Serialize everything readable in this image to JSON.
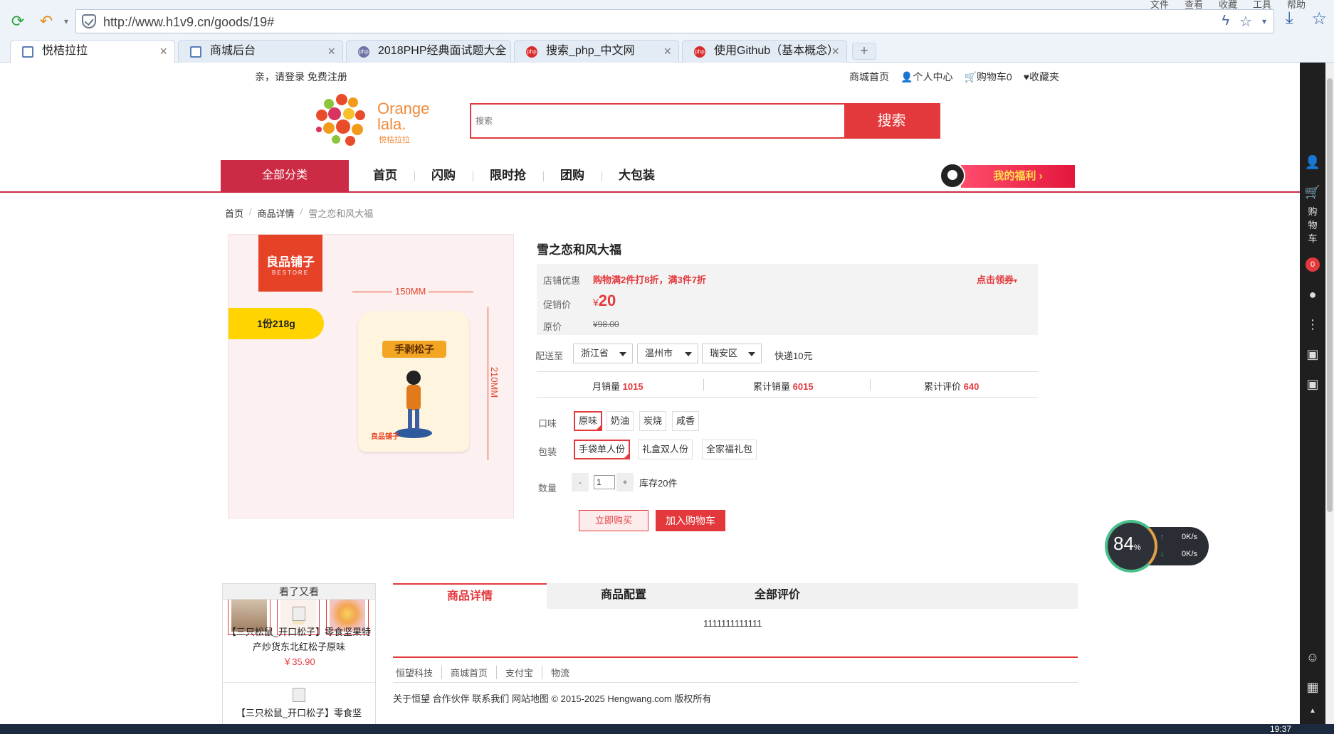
{
  "browser": {
    "menu": [
      "文件",
      "查看",
      "收藏",
      "工具",
      "帮助"
    ],
    "url": "http://www.h1v9.cn/goods/19#",
    "tabs": [
      {
        "title": "悦桔拉拉",
        "icon": "doc"
      },
      {
        "title": "商城后台",
        "icon": "doc"
      },
      {
        "title": "2018PHP经典面试题大全",
        "icon": "php"
      },
      {
        "title": "搜索_php_中文网",
        "icon": "php-red"
      },
      {
        "title": "使用Github（基本概念）",
        "icon": "php-red"
      }
    ],
    "new_tab": "+",
    "sidebar_cart": "购物车",
    "sidebar_cart_count": "0",
    "clock": "19:37"
  },
  "site": {
    "login_prompt": "亲，请登录 免费注册",
    "top_links": [
      "商城首页",
      "个人中心",
      "购物车0",
      "收藏夹"
    ],
    "logo_text": "Orange lala.",
    "logo_sub": "悦桔拉拉",
    "search_placeholder": "搜索",
    "search_button": "搜索",
    "category_button": "全部分类",
    "nav": [
      "首页",
      "闪购",
      "限时抢",
      "团购",
      "大包装"
    ],
    "welfare": "我的福利 ›",
    "breadcrumb": [
      "首页",
      "商品详情",
      "雪之恋和风大福"
    ]
  },
  "product": {
    "title": "雪之恋和风大福",
    "image": {
      "brand": "良品铺子",
      "brand_en": "BESTORE",
      "weight": "1份218g",
      "bag_name": "手剥松子",
      "width_label": "150MM",
      "height_label": "210MM"
    },
    "store_promo_label": "店铺优惠",
    "store_promo": "购物满2件打8折，满3件7折",
    "coupon": "点击领券",
    "price_label": "促销价",
    "currency": "¥",
    "price": "20",
    "orig_price_label": "原价",
    "orig_price": "¥98.00",
    "ship_label": "配送至",
    "province": "浙江省",
    "city": "温州市",
    "district": "瑞安区",
    "shipping": "快递10元",
    "monthly_sales_label": "月销量",
    "monthly_sales": "1015",
    "total_sales_label": "累计销量",
    "total_sales": "6015",
    "reviews_label": "累计评价",
    "reviews": "640",
    "flavor_label": "口味",
    "flavors": [
      "原味",
      "奶油",
      "炭烧",
      "咸香"
    ],
    "selected_flavor": 0,
    "package_label": "包装",
    "packages": [
      "手袋单人份",
      "礼盒双人份",
      "全家福礼包"
    ],
    "selected_package": 0,
    "qty_label": "数量",
    "qty_minus": "-",
    "qty": "1",
    "qty_plus": "+",
    "stock": "库存20件",
    "buy_now": "立即购买",
    "add_cart": "加入购物车"
  },
  "see_also": {
    "title": "看了又看",
    "items": [
      {
        "name": "【三只松鼠_开口松子】零食坚果特产炒货东北红松子原味",
        "price": "￥35.90"
      },
      {
        "name": "【三只松鼠_开口松子】零食坚",
        "price": ""
      }
    ]
  },
  "detail_tabs": [
    "商品详情",
    "商品配置",
    "全部评价"
  ],
  "detail_text": "1111111111111",
  "footer": {
    "links": [
      "恒望科技",
      "商城首页",
      "支付宝",
      "物流"
    ],
    "copyright": "关于恒望 合作伙伴 联系我们 网站地图 © 2015-2025 Hengwang.com 版权所有"
  },
  "speed_widget": {
    "percent": "84",
    "unit": "%",
    "up": "0K/s",
    "down": "0K/s"
  }
}
